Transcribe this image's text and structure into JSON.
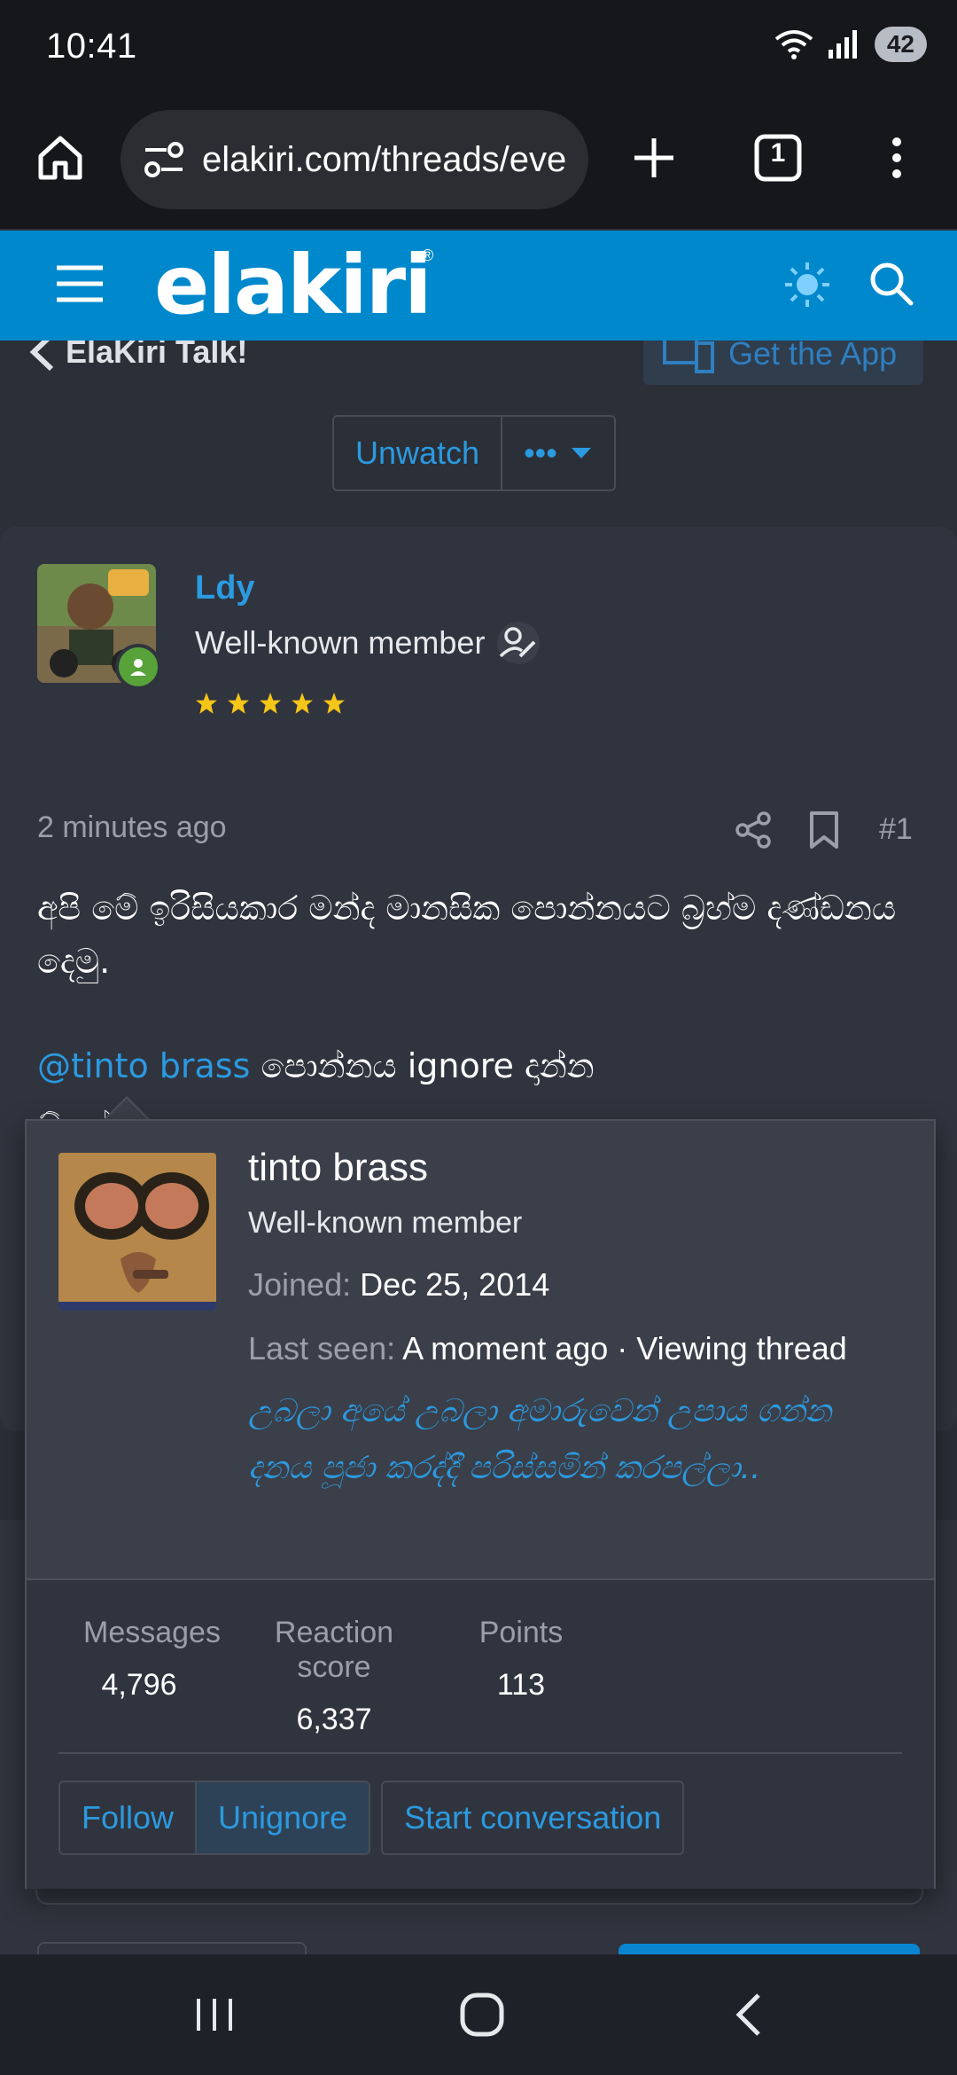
{
  "status_bar": {
    "time": "10:41",
    "battery": "42",
    "icons": [
      "wifi-icon",
      "signal-icon",
      "battery-icon"
    ]
  },
  "browser": {
    "url": "elakiri.com/threads/eve",
    "tab_count": "1",
    "icons": [
      "home-icon",
      "site-settings-icon",
      "new-tab-icon",
      "tabs-icon",
      "more-menu-icon"
    ]
  },
  "site_header": {
    "logo_text": "elakiri",
    "logo_mark": "®",
    "brand_color": "#0088cc",
    "icons": [
      "hamburger-icon",
      "theme-icon",
      "search-icon"
    ]
  },
  "page": {
    "breadcrumb": "ElaKiri Talk!",
    "get_app_label": "Get the App",
    "unwatch_label": "Unwatch",
    "more_label": "•••"
  },
  "post": {
    "author": "Ldy",
    "user_title": "Well-known member",
    "stars": 5,
    "time": "2 minutes ago",
    "number": "#1",
    "body_line1": "අපි මේ ඉරිසියකාර මන්ද මානසික පොන්නයට බ්‍රහ්ම දණ්ඩනය දෙමු.",
    "mention": "@tinto brass",
    "body_line2_rest": " පොන්නය ignore දාන්න",
    "body_line3": "ඕනේම්..."
  },
  "popover": {
    "name": "tinto brass",
    "title": "Well-known member",
    "joined_label": "Joined:",
    "joined_value": "Dec 25, 2014",
    "last_seen_label": "Last seen:",
    "last_seen_value": "A moment ago · Viewing thread",
    "signature": "උබලා අයේ උබලා අමාරුවෙන් උපාය ගන්න දනය පූජා කරද්දී පරිස්සමින් කරපල්ලා..",
    "stats": [
      {
        "label": "Messages",
        "value": "4,796"
      },
      {
        "label": "Reaction score",
        "value": "6,337"
      },
      {
        "label": "Points",
        "value": "113"
      }
    ],
    "follow_label": "Follow",
    "unignore_label": "Unignore",
    "start_conversation_label": "Start conversation"
  },
  "colors": {
    "accent": "#2b9ae0",
    "background": "#2b2f38",
    "star": "#f5c518"
  }
}
